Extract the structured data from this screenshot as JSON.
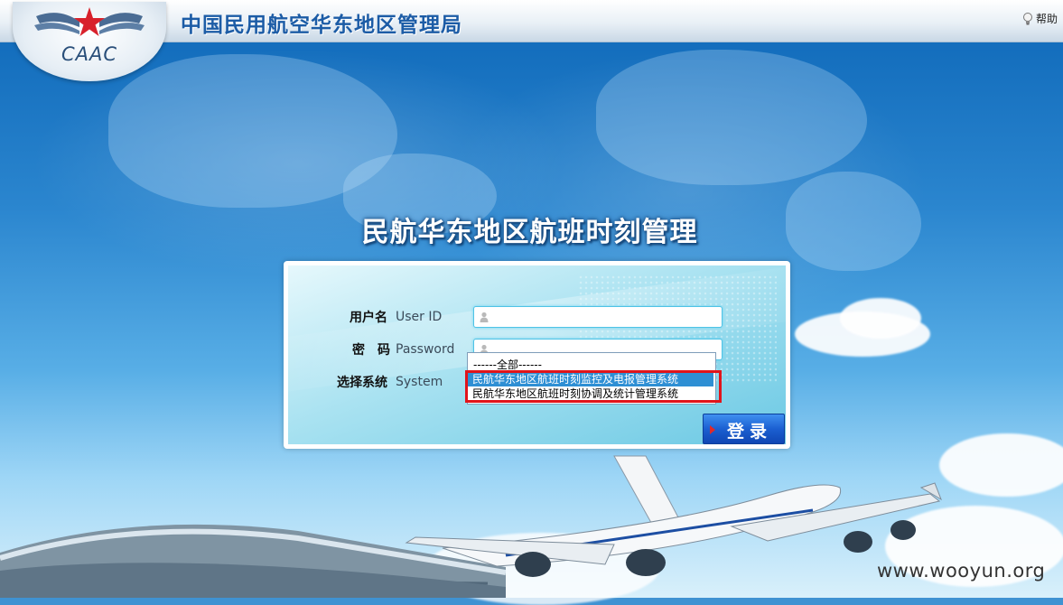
{
  "header": {
    "logo_text": "CAAC",
    "agency_title": "中国民用航空华东地区管理局",
    "help_label": "帮助",
    "help_icon": "lightbulb-icon"
  },
  "page_title": "民航华东地区航班时刻管理",
  "login": {
    "username_label": "用户名",
    "username_en": "User ID",
    "username_value": "",
    "password_label": "密　码",
    "password_en": "Password",
    "system_label": "选择系统",
    "system_en": "System",
    "system_options": [
      "------全部------",
      "民航华东地区航班时刻监控及电报管理系统",
      "民航华东地区航班时刻协调及统计管理系统"
    ],
    "login_button": "登录"
  },
  "watermark": "www.wooyun.org",
  "colors": {
    "highlight_box": "#e1141b",
    "selected_option_bg": "#2e8fd4",
    "login_button": "#1b5fd1"
  }
}
